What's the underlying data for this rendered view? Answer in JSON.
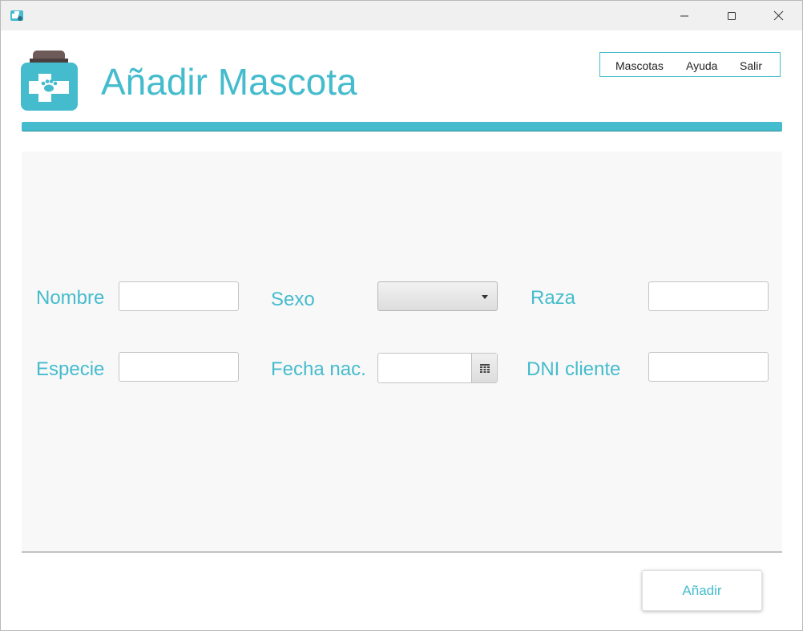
{
  "window": {
    "controls": {
      "minimize_icon": "minimize-icon",
      "maximize_icon": "maximize-icon",
      "close_icon": "close-icon"
    }
  },
  "header": {
    "logo_icon": "pet-medicine-bottle-icon",
    "title": "Añadir Mascota"
  },
  "menu": {
    "items": [
      {
        "label": "Mascotas"
      },
      {
        "label": "Ayuda"
      },
      {
        "label": "Salir"
      }
    ]
  },
  "form": {
    "nombre": {
      "label": "Nombre",
      "value": ""
    },
    "sexo": {
      "label": "Sexo",
      "selected": ""
    },
    "raza": {
      "label": "Raza",
      "value": ""
    },
    "especie": {
      "label": "Especie",
      "value": ""
    },
    "fecha_nac": {
      "label": "Fecha nac.",
      "value": "",
      "icon": "calendar-icon"
    },
    "dni_cliente": {
      "label": "DNI cliente",
      "value": ""
    }
  },
  "actions": {
    "add_label": "Añadir"
  },
  "colors": {
    "accent": "#45bccd",
    "panel_bg": "#f8f8f8"
  }
}
